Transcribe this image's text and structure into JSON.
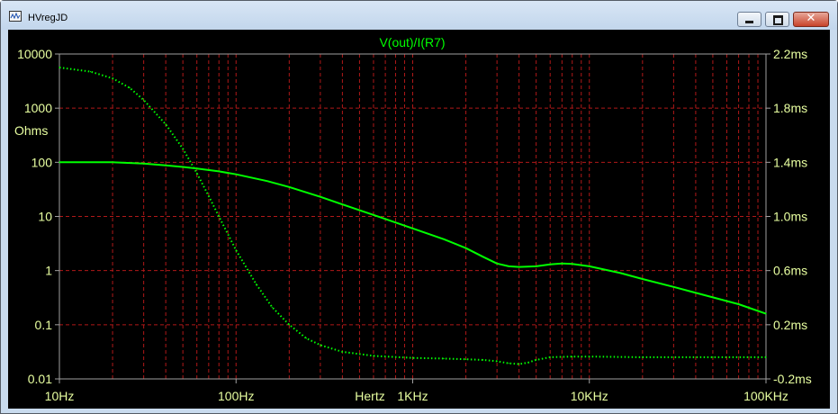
{
  "window": {
    "title": "HVregJD",
    "close_glyph": "✕"
  },
  "chart_data": {
    "type": "line",
    "title": "V(out)/I(R7)",
    "xlabel": "Hertz",
    "ylabel_left": "Ohms",
    "x_scale": "log",
    "y_left_scale": "log",
    "xlim": [
      10,
      100000
    ],
    "ylim_left": [
      0.01,
      10000
    ],
    "ylim_right_ms": [
      -0.2,
      2.2
    ],
    "x_ticks": [
      "10Hz",
      "100Hz",
      "1KHz",
      "10KHz",
      "100KHz"
    ],
    "y_left_ticks": [
      "10000",
      "1000",
      "100",
      "10",
      "1",
      "0.1",
      "0.01"
    ],
    "y_right_ticks": [
      "2.2ms",
      "1.8ms",
      "1.4ms",
      "1.0ms",
      "0.6ms",
      "0.2ms",
      "-0.2ms"
    ],
    "grid": true,
    "colors": {
      "background": "#000000",
      "grid": "#b01818",
      "trace": "#00ff00",
      "text": "#e8ffa0",
      "title": "#00ff00"
    },
    "series": [
      {
        "axis": "left",
        "style": "solid",
        "quantity": "magnitude (Ohms)",
        "x": [
          10,
          20,
          30,
          40,
          50,
          60,
          80,
          100,
          150,
          200,
          300,
          500,
          700,
          1000,
          1500,
          2000,
          2500,
          3000,
          3500,
          4000,
          5000,
          6000,
          7000,
          8000,
          10000,
          15000,
          20000,
          30000,
          50000,
          70000,
          100000
        ],
        "y": [
          100,
          100,
          95,
          88,
          82,
          77,
          68,
          60,
          45,
          35,
          23,
          13,
          9,
          6,
          3.8,
          2.6,
          1.8,
          1.35,
          1.2,
          1.17,
          1.2,
          1.3,
          1.35,
          1.33,
          1.2,
          0.9,
          0.7,
          0.5,
          0.32,
          0.24,
          0.16
        ]
      },
      {
        "axis": "right",
        "style": "dotted",
        "quantity": "group delay (ms)",
        "x": [
          10,
          15,
          20,
          25,
          30,
          40,
          50,
          60,
          70,
          80,
          100,
          130,
          160,
          200,
          250,
          300,
          400,
          600,
          1000,
          1500,
          2000,
          2500,
          3000,
          3500,
          4000,
          4500,
          5000,
          6000,
          8000,
          10000,
          20000,
          50000,
          100000
        ],
        "y": [
          2.1,
          2.07,
          2.02,
          1.95,
          1.86,
          1.68,
          1.5,
          1.32,
          1.15,
          1.0,
          0.75,
          0.5,
          0.33,
          0.2,
          0.1,
          0.05,
          0.0,
          -0.03,
          -0.045,
          -0.05,
          -0.055,
          -0.06,
          -0.07,
          -0.085,
          -0.09,
          -0.08,
          -0.06,
          -0.04,
          -0.035,
          -0.035,
          -0.04,
          -0.04,
          -0.04
        ]
      }
    ]
  }
}
